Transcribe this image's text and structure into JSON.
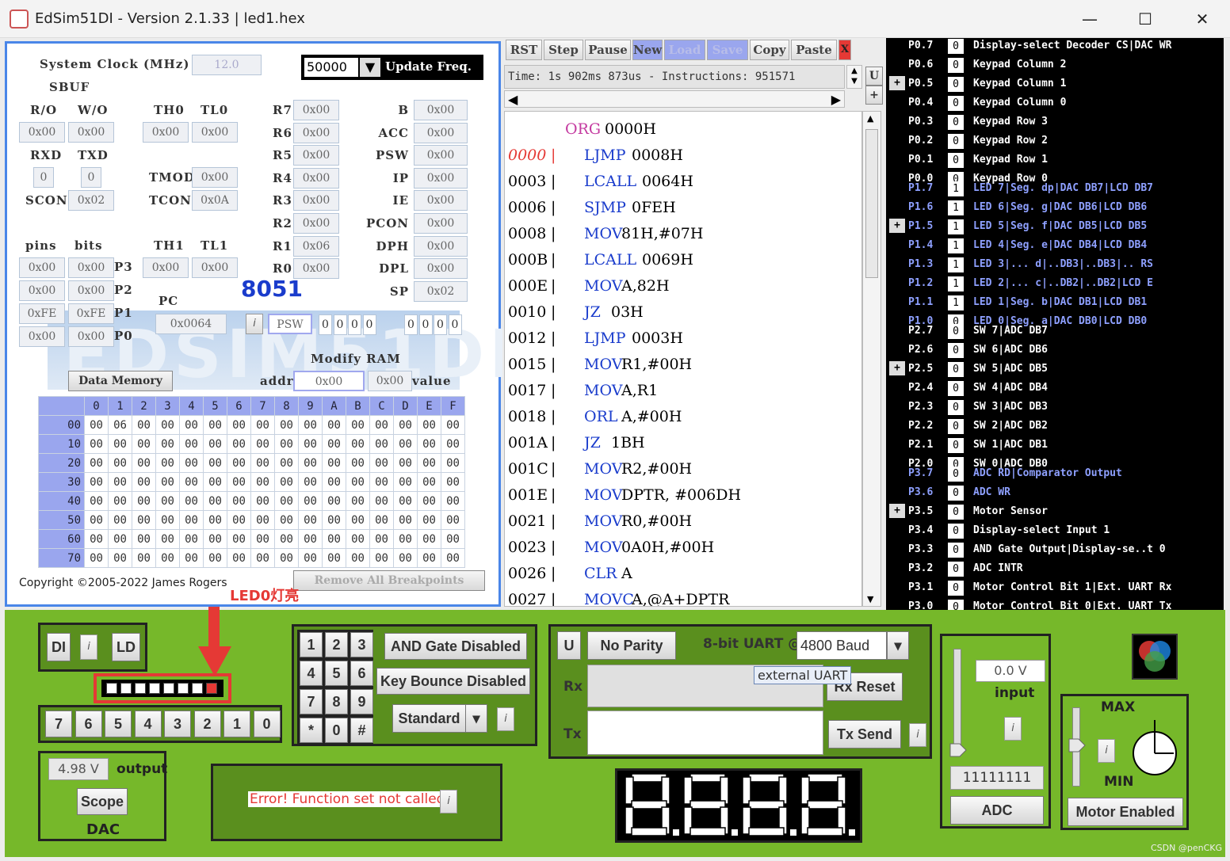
{
  "window": {
    "title": "EdSim51DI - Version 2.1.33 | led1.hex"
  },
  "regs": {
    "system_clock_label": "System Clock (MHz)",
    "system_clock": "12.0",
    "update_freq": "50000",
    "update_freq_label": "Update Freq.",
    "sbuf_label": "SBUF",
    "ro_label": "R/O",
    "wo_label": "W/O",
    "sbuf_ro": "0x00",
    "sbuf_wo": "0x00",
    "th0_label": "TH0",
    "tl0_label": "TL0",
    "th0": "0x00",
    "tl0": "0x00",
    "rxd_label": "RXD",
    "txd_label": "TXD",
    "rxd": "0",
    "txd": "0",
    "tmod_label": "TMOD",
    "tmod": "0x00",
    "scon_label": "SCON",
    "scon": "0x02",
    "tcon_label": "TCON",
    "tcon": "0x0A",
    "pins_label": "pins",
    "bits_label": "bits",
    "th1_label": "TH1",
    "tl1_label": "TL1",
    "th1": "0x00",
    "tl1": "0x00",
    "rregs": [
      {
        "n": "R7",
        "v": "0x00"
      },
      {
        "n": "R6",
        "v": "0x00"
      },
      {
        "n": "R5",
        "v": "0x00"
      },
      {
        "n": "R4",
        "v": "0x00"
      },
      {
        "n": "R3",
        "v": "0x00"
      },
      {
        "n": "R2",
        "v": "0x00"
      },
      {
        "n": "R1",
        "v": "0x06"
      },
      {
        "n": "R0",
        "v": "0x00"
      }
    ],
    "sfr": [
      {
        "n": "B",
        "v": "0x00"
      },
      {
        "n": "ACC",
        "v": "0x00"
      },
      {
        "n": "PSW",
        "v": "0x00"
      },
      {
        "n": "IP",
        "v": "0x00"
      },
      {
        "n": "IE",
        "v": "0x00"
      },
      {
        "n": "PCON",
        "v": "0x00"
      },
      {
        "n": "DPH",
        "v": "0x00"
      },
      {
        "n": "DPL",
        "v": "0x00"
      },
      {
        "n": "SP",
        "v": "0x02"
      }
    ],
    "ports": [
      {
        "pins": "0x00",
        "bits": "0x00",
        "n": "P3"
      },
      {
        "pins": "0x00",
        "bits": "0x00",
        "n": "P2"
      },
      {
        "pins": "0xFE",
        "bits": "0xFE",
        "n": "P1"
      },
      {
        "pins": "0x00",
        "bits": "0x00",
        "n": "P0"
      }
    ],
    "chip": "8051",
    "pc_label": "PC",
    "pc": "0x0064",
    "psw_btn": "PSW",
    "psw_bits_a": [
      "0",
      "0",
      "0",
      "0"
    ],
    "psw_bits_b": [
      "0",
      "0",
      "0",
      "0"
    ],
    "modify_ram": "Modify RAM",
    "addr_label": "addr",
    "addr": "0x00",
    "value": "0x00",
    "value_label": "value",
    "data_memory_btn": "Data Memory",
    "info": "i",
    "copyright": "Copyright ©2005-2022 James Rogers",
    "remove_bp": "Remove All Breakpoints"
  },
  "memory": {
    "cols": [
      "0",
      "1",
      "2",
      "3",
      "4",
      "5",
      "6",
      "7",
      "8",
      "9",
      "A",
      "B",
      "C",
      "D",
      "E",
      "F"
    ],
    "rows": [
      {
        "r": "00",
        "c": [
          "00",
          "06",
          "00",
          "00",
          "00",
          "00",
          "00",
          "00",
          "00",
          "00",
          "00",
          "00",
          "00",
          "00",
          "00",
          "00"
        ]
      },
      {
        "r": "10",
        "c": [
          "00",
          "00",
          "00",
          "00",
          "00",
          "00",
          "00",
          "00",
          "00",
          "00",
          "00",
          "00",
          "00",
          "00",
          "00",
          "00"
        ]
      },
      {
        "r": "20",
        "c": [
          "00",
          "00",
          "00",
          "00",
          "00",
          "00",
          "00",
          "00",
          "00",
          "00",
          "00",
          "00",
          "00",
          "00",
          "00",
          "00"
        ]
      },
      {
        "r": "30",
        "c": [
          "00",
          "00",
          "00",
          "00",
          "00",
          "00",
          "00",
          "00",
          "00",
          "00",
          "00",
          "00",
          "00",
          "00",
          "00",
          "00"
        ]
      },
      {
        "r": "40",
        "c": [
          "00",
          "00",
          "00",
          "00",
          "00",
          "00",
          "00",
          "00",
          "00",
          "00",
          "00",
          "00",
          "00",
          "00",
          "00",
          "00"
        ]
      },
      {
        "r": "50",
        "c": [
          "00",
          "00",
          "00",
          "00",
          "00",
          "00",
          "00",
          "00",
          "00",
          "00",
          "00",
          "00",
          "00",
          "00",
          "00",
          "00"
        ]
      },
      {
        "r": "60",
        "c": [
          "00",
          "00",
          "00",
          "00",
          "00",
          "00",
          "00",
          "00",
          "00",
          "00",
          "00",
          "00",
          "00",
          "00",
          "00",
          "00"
        ]
      },
      {
        "r": "70",
        "c": [
          "00",
          "00",
          "00",
          "00",
          "00",
          "00",
          "00",
          "00",
          "00",
          "00",
          "00",
          "00",
          "00",
          "00",
          "00",
          "00"
        ]
      }
    ]
  },
  "toolbar": [
    "RST",
    "Step",
    "Pause",
    "New",
    "Load",
    "Save",
    "Copy",
    "Paste",
    "X"
  ],
  "status": "Time: 1s 902ms 873us - Instructions: 951571",
  "side_btns": [
    "U",
    "+"
  ],
  "code": [
    {
      "a": "",
      "m": "ORG",
      "o": "0000H",
      "org": true
    },
    {
      "a": "0000",
      "m": "LJMP",
      "o": "0008H",
      "red": true
    },
    {
      "a": "0003",
      "m": "LCALL",
      "o": "0064H"
    },
    {
      "a": "0006",
      "m": "SJMP",
      "o": "0FEH"
    },
    {
      "a": "0008",
      "m": "MOV",
      "o": "81H,#07H"
    },
    {
      "a": "000B",
      "m": "LCALL",
      "o": "0069H"
    },
    {
      "a": "000E",
      "m": "MOV",
      "o": "A,82H"
    },
    {
      "a": "0010",
      "m": "JZ",
      "o": "03H"
    },
    {
      "a": "0012",
      "m": "LJMP",
      "o": "0003H"
    },
    {
      "a": "0015",
      "m": "MOV",
      "o": "R1,#00H"
    },
    {
      "a": "0017",
      "m": "MOV",
      "o": "A,R1"
    },
    {
      "a": "0018",
      "m": "ORL",
      "o": "A,#00H"
    },
    {
      "a": "001A",
      "m": "JZ",
      "o": "1BH"
    },
    {
      "a": "001C",
      "m": "MOV",
      "o": "R2,#00H"
    },
    {
      "a": "001E",
      "m": "MOV",
      "o": "DPTR, #006DH"
    },
    {
      "a": "0021",
      "m": "MOV",
      "o": "R0,#00H"
    },
    {
      "a": "0023",
      "m": "MOV",
      "o": "0A0H,#00H"
    },
    {
      "a": "0026",
      "m": "CLR",
      "o": "A"
    },
    {
      "a": "0027",
      "m": "MOVC",
      "o": "A,@A+DPTR"
    }
  ],
  "port_rows": [
    {
      "p": "P0.7",
      "b": "0",
      "d": "Display-select Decoder CS|DAC WR"
    },
    {
      "p": "P0.6",
      "b": "0",
      "d": "Keypad Column 2"
    },
    {
      "p": "P0.5",
      "b": "0",
      "d": "Keypad Column 1",
      "plus": true
    },
    {
      "p": "P0.4",
      "b": "0",
      "d": "Keypad Column 0"
    },
    {
      "p": "P0.3",
      "b": "0",
      "d": "Keypad Row 3"
    },
    {
      "p": "P0.2",
      "b": "0",
      "d": "Keypad Row 2"
    },
    {
      "p": "P0.1",
      "b": "0",
      "d": "Keypad Row 1"
    },
    {
      "p": "P0.0",
      "b": "0",
      "d": "Keypad Row 0"
    },
    {
      "p": "P1.7",
      "b": "1",
      "d": "LED 7|Seg. dp|DAC DB7|LCD DB7",
      "blue": true
    },
    {
      "p": "P1.6",
      "b": "1",
      "d": "LED 6|Seg. g|DAC DB6|LCD DB6",
      "blue": true
    },
    {
      "p": "P1.5",
      "b": "1",
      "d": "LED 5|Seg. f|DAC DB5|LCD DB5",
      "blue": true,
      "plus": true
    },
    {
      "p": "P1.4",
      "b": "1",
      "d": "LED 4|Seg. e|DAC DB4|LCD DB4",
      "blue": true
    },
    {
      "p": "P1.3",
      "b": "1",
      "d": "LED 3|... d|..DB3|..DB3|.. RS",
      "blue": true
    },
    {
      "p": "P1.2",
      "b": "1",
      "d": "LED 2|... c|..DB2|..DB2|LCD E",
      "blue": true
    },
    {
      "p": "P1.1",
      "b": "1",
      "d": "LED 1|Seg. b|DAC DB1|LCD DB1",
      "blue": true
    },
    {
      "p": "P1.0",
      "b": "0",
      "d": "LED 0|Seg. a|DAC DB0|LCD DB0",
      "blue": true
    },
    {
      "p": "P2.7",
      "b": "0",
      "d": "SW 7|ADC DB7"
    },
    {
      "p": "P2.6",
      "b": "0",
      "d": "SW 6|ADC DB6"
    },
    {
      "p": "P2.5",
      "b": "0",
      "d": "SW 5|ADC DB5",
      "plus": true
    },
    {
      "p": "P2.4",
      "b": "0",
      "d": "SW 4|ADC DB4"
    },
    {
      "p": "P2.3",
      "b": "0",
      "d": "SW 3|ADC DB3"
    },
    {
      "p": "P2.2",
      "b": "0",
      "d": "SW 2|ADC DB2"
    },
    {
      "p": "P2.1",
      "b": "0",
      "d": "SW 1|ADC DB1"
    },
    {
      "p": "P2.0",
      "b": "0",
      "d": "SW 0|ADC DB0"
    },
    {
      "p": "P3.7",
      "b": "0",
      "d": "ADC RD|Comparator Output",
      "blue": true
    },
    {
      "p": "P3.6",
      "b": "0",
      "d": "ADC WR",
      "blue": true
    },
    {
      "p": "P3.5",
      "b": "0",
      "d": "Motor Sensor",
      "plus": true
    },
    {
      "p": "P3.4",
      "b": "0",
      "d": "Display-select Input 1"
    },
    {
      "p": "P3.3",
      "b": "0",
      "d": "AND Gate Output|Display-se..t 0"
    },
    {
      "p": "P3.2",
      "b": "0",
      "d": "ADC INTR"
    },
    {
      "p": "P3.1",
      "b": "0",
      "d": "Motor Control Bit 1|Ext. UART Rx"
    },
    {
      "p": "P3.0",
      "b": "0",
      "d": "Motor Control Bit 0|Ext. UART Tx"
    }
  ],
  "bottom": {
    "di": "DI",
    "ld": "LD",
    "info": "i",
    "annotation": "LED0灯亮",
    "leds": [
      0,
      0,
      0,
      0,
      0,
      0,
      0,
      1
    ],
    "switches": [
      "7",
      "6",
      "5",
      "4",
      "3",
      "2",
      "1",
      "0"
    ],
    "dac_value": "4.98 V",
    "dac_output": "output",
    "scope": "Scope",
    "dac": "DAC",
    "keypad": [
      "1",
      "2",
      "3",
      "4",
      "5",
      "6",
      "7",
      "8",
      "9",
      "*",
      "0",
      "#"
    ],
    "and_gate": "AND Gate Disabled",
    "key_bounce": "Key Bounce Disabled",
    "standard": "Standard",
    "lcd_msg": "Error! Function set not called.",
    "uart_u": "U",
    "parity": "No Parity",
    "uart_label": "8-bit UART @",
    "baud": "4800 Baud",
    "rx": "Rx",
    "tx": "Tx",
    "tooltip": "external UART",
    "rx_reset": "Rx Reset",
    "tx_send": "Tx Send",
    "seg_display": "8.8.8.8.",
    "adc_v": "0.0 V",
    "adc_input": "input",
    "adc_bits": "11111111",
    "adc": "ADC",
    "max": "MAX",
    "min": "MIN",
    "motor": "Motor Enabled",
    "watermark": "CSDN @penCKG"
  }
}
